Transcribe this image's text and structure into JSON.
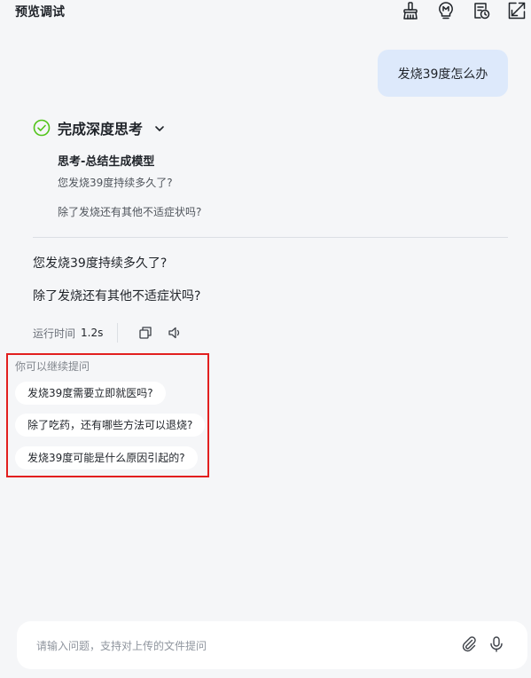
{
  "header": {
    "title": "预览调试",
    "icons": [
      "broom-icon",
      "memory-icon",
      "document-clock-icon",
      "expand-icon"
    ]
  },
  "chat": {
    "user_message": "发烧39度怎么办",
    "thinking": {
      "status_label": "完成深度思考",
      "step_title": "思考-总结生成模型",
      "lines": [
        "您发烧39度持续多久了?",
        "除了发烧还有其他不适症状吗?"
      ]
    },
    "answer": {
      "lines": [
        "您发烧39度持续多久了?",
        "除了发烧还有其他不适症状吗?"
      ]
    },
    "meta": {
      "runtime_label": "运行时间",
      "runtime_value": "1.2s"
    },
    "suggestions": {
      "heading": "你可以继续提问",
      "items": [
        "发烧39度需要立即就医吗?",
        "除了吃药，还有哪些方法可以退烧?",
        "发烧39度可能是什么原因引起的?"
      ]
    }
  },
  "input": {
    "placeholder": "请输入问题，支持对上传的文件提问",
    "value": ""
  },
  "colors": {
    "background": "#f5f6f8",
    "user_bubble": "#dde9fb",
    "check_green": "#52c41a",
    "highlight_box": "#e21f1f"
  }
}
